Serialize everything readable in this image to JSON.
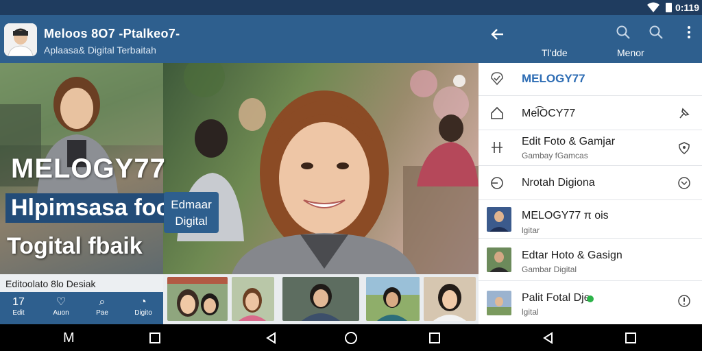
{
  "status_bar": {
    "time": "0:119",
    "icons": [
      "wifi-icon",
      "battery-icon"
    ]
  },
  "header": {
    "title": "Meloos 8O7 -Ptalkeo7-",
    "subtitle": "Aplaasa& Digital Terbaitah"
  },
  "right_header": {
    "icons": [
      "back-arrow-icon",
      "search-icon",
      "search-icon",
      "more-vert-icon"
    ],
    "tabs": [
      {
        "label": "Tl'dde"
      },
      {
        "label": "Menor"
      }
    ]
  },
  "hero": {
    "title": "MELOGY77",
    "tagline_line1": "Hlpimsasa foo",
    "tagline_line2": "Togital fbaik",
    "badge": "Edmaar Digital"
  },
  "caption": "Editoolato 8lo Desiak",
  "bottom_nav": [
    {
      "icon": "edit-icon",
      "glyph": "17",
      "label": "Edit"
    },
    {
      "icon": "heart-icon",
      "glyph": "♡",
      "label": "Auon"
    },
    {
      "icon": "search-icon",
      "glyph": "⌕",
      "label": "Pae"
    },
    {
      "icon": "dashboard-icon",
      "glyph": "◔",
      "label": "Digito"
    }
  ],
  "list": {
    "header": "MELOGY77",
    "items": [
      {
        "title": "Mel͡OCY77",
        "subtitle": "",
        "lead": "home-icon",
        "trail": "pin-icon"
      },
      {
        "title": "Edit Foto & Gamjar",
        "subtitle": "Gambay fGamcas",
        "lead": "adjust-icon",
        "trail": "shield-icon"
      },
      {
        "title": "Nrotah Digiona",
        "subtitle": "",
        "lead": "shape-icon",
        "trail": "chevron-circle-icon"
      },
      {
        "title": "MELOGY77 π ois",
        "subtitle": "lgitar",
        "lead": "photo",
        "trail": ""
      },
      {
        "title": "Edtar Hoto & Gasign",
        "subtitle": "Gambar Digital",
        "lead": "photo",
        "trail": ""
      },
      {
        "title": "Palit Fotal Dje",
        "subtitle": "lgital",
        "lead": "photo",
        "trail": "info-icon",
        "status_color": "#2db34a"
      }
    ]
  },
  "system_nav": [
    "menu-icon",
    "recents-icon",
    "back-icon",
    "home-icon",
    "recents-icon",
    "back-icon",
    "recents-icon"
  ],
  "system_nav_glyph": "M",
  "colors": {
    "primary": "#2e5f8e",
    "status_bar": "#1f3c5f",
    "accent": "#2e6db4"
  }
}
